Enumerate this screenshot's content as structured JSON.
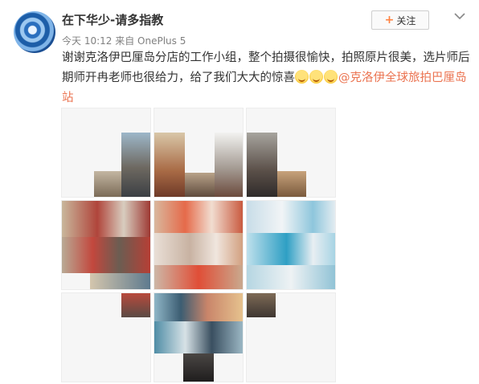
{
  "post": {
    "username": "在下华少-请多指教",
    "meta": "今天 10:12 来自 OnePlus 5",
    "follow_label": "关注",
    "text": "谢谢克洛伊巴厘岛分店的工作小组，整个拍摄很愉快，拍照原片很美，选片师后期师开冉老师也很给力，给了我们大大的惊喜",
    "mention": "克洛伊全球旅拍巴厘岛站"
  },
  "icons": [
    "avatar",
    "plus-icon",
    "chevron-down-icon",
    "emoji-icon",
    "at-icon"
  ],
  "colors": {
    "link": "#eb7350",
    "follow_plus": "#ff8140",
    "meta": "#808080"
  },
  "images": {
    "count": 9,
    "alts": [
      "婚纱照拼图1",
      "婚纱照拼图2",
      "婚纱照拼图3",
      "婚纱照拼图4",
      "婚纱照拼图5",
      "婚纱照拼图6",
      "婚纱照拼图7",
      "婚纱照拼图8",
      "婚纱照拼图9"
    ]
  }
}
